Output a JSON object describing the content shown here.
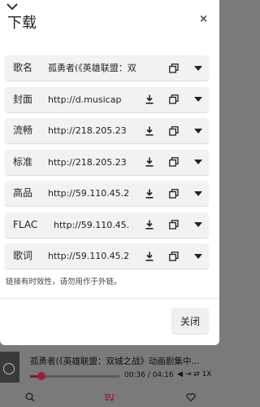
{
  "dialog": {
    "title": "下载",
    "close_x": "×",
    "rows": [
      {
        "label": "歌名",
        "value": "孤勇者(《英雄联盟：双",
        "has_download": false
      },
      {
        "label": "封面",
        "value": "http://d.musicap",
        "has_download": true
      },
      {
        "label": "流畅",
        "value": "http://218.205.23",
        "has_download": true
      },
      {
        "label": "标准",
        "value": "http://218.205.23",
        "has_download": true
      },
      {
        "label": "高品",
        "value": "http://59.110.45.2",
        "has_download": true
      },
      {
        "label": "FLAC",
        "value": "http://59.110.45.",
        "has_download": true
      },
      {
        "label": "歌词",
        "value": "http://59.110.45.2",
        "has_download": true
      }
    ],
    "hint": "链接有时效性，请勿用作于外链。",
    "close_button": "关闭"
  },
  "player": {
    "song_title": "孤勇者(《英雄联盟：双城之战》动画剧集中...",
    "time": "00:36 / 04:16",
    "progress": 0.14,
    "controls": "◀ ⇥ ⇄ 1X"
  },
  "colors": {
    "accent": "#a01c34",
    "overlay": "#7a7a7a",
    "row_bg": "#f2f2f2"
  },
  "icons": [
    "chevron-down-icon",
    "download-icon",
    "copy-icon",
    "dropdown-arrow-icon",
    "search-icon",
    "music-list-icon",
    "heart-icon"
  ]
}
